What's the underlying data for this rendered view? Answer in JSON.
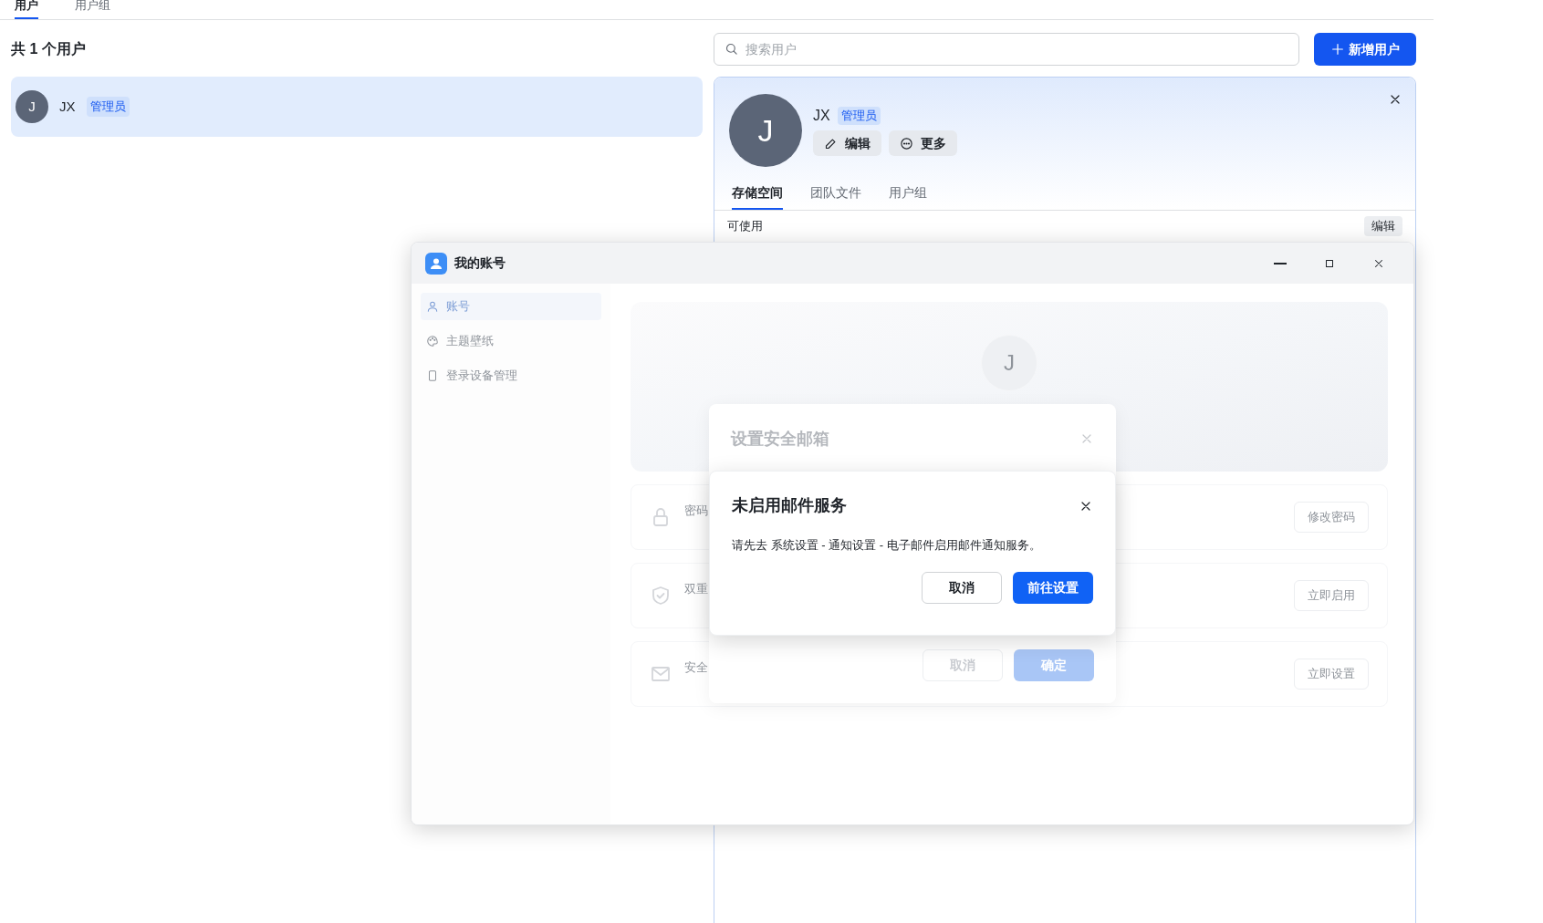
{
  "top_tabs": [
    {
      "label": "用户",
      "selected": true
    },
    {
      "label": "用户组",
      "selected": false
    }
  ],
  "user_list": {
    "heading": "共 1 个用户",
    "users": [
      {
        "initial": "J",
        "name": "JX",
        "role": "管理员",
        "selected": true
      }
    ]
  },
  "search": {
    "placeholder": "搜索用户"
  },
  "add_button": {
    "label": "新增用户"
  },
  "detail_panel": {
    "initial": "J",
    "name": "JX",
    "role": "管理员",
    "actions": [
      {
        "kind": "edit",
        "label": "编辑"
      },
      {
        "kind": "more",
        "label": "更多"
      }
    ],
    "tabs": [
      {
        "label": "存储空间",
        "selected": true
      },
      {
        "label": "团队文件",
        "selected": false
      },
      {
        "label": "用户组",
        "selected": false
      }
    ],
    "section_label": "可使用",
    "section_action": "编辑"
  },
  "account_window": {
    "title": "我的账号",
    "sidebar": [
      {
        "kind": "user",
        "label": "账号",
        "selected": true
      },
      {
        "kind": "palette",
        "label": "主题壁纸",
        "selected": false
      },
      {
        "kind": "device",
        "label": "登录设备管理",
        "selected": false
      }
    ],
    "avatar_initial": "J",
    "rows": [
      {
        "kind": "lock",
        "title": "密码",
        "action": "修改密码"
      },
      {
        "kind": "shield",
        "title": "双重",
        "action": "立即启用"
      },
      {
        "kind": "mail",
        "title": "安全",
        "action": "立即设置"
      }
    ]
  },
  "email_dialog": {
    "title": "设置安全邮箱",
    "buttons": [
      {
        "kind": "secondary",
        "label": "取消"
      },
      {
        "kind": "primary",
        "label": "确定"
      }
    ]
  },
  "alert_dialog": {
    "title": "未启用邮件服务",
    "message": "请先去 系统设置 - 通知设置 - 电子邮件启用邮件通知服务。",
    "buttons": [
      {
        "kind": "secondary",
        "label": "取消"
      },
      {
        "kind": "primary",
        "label": "前往设置"
      }
    ]
  }
}
